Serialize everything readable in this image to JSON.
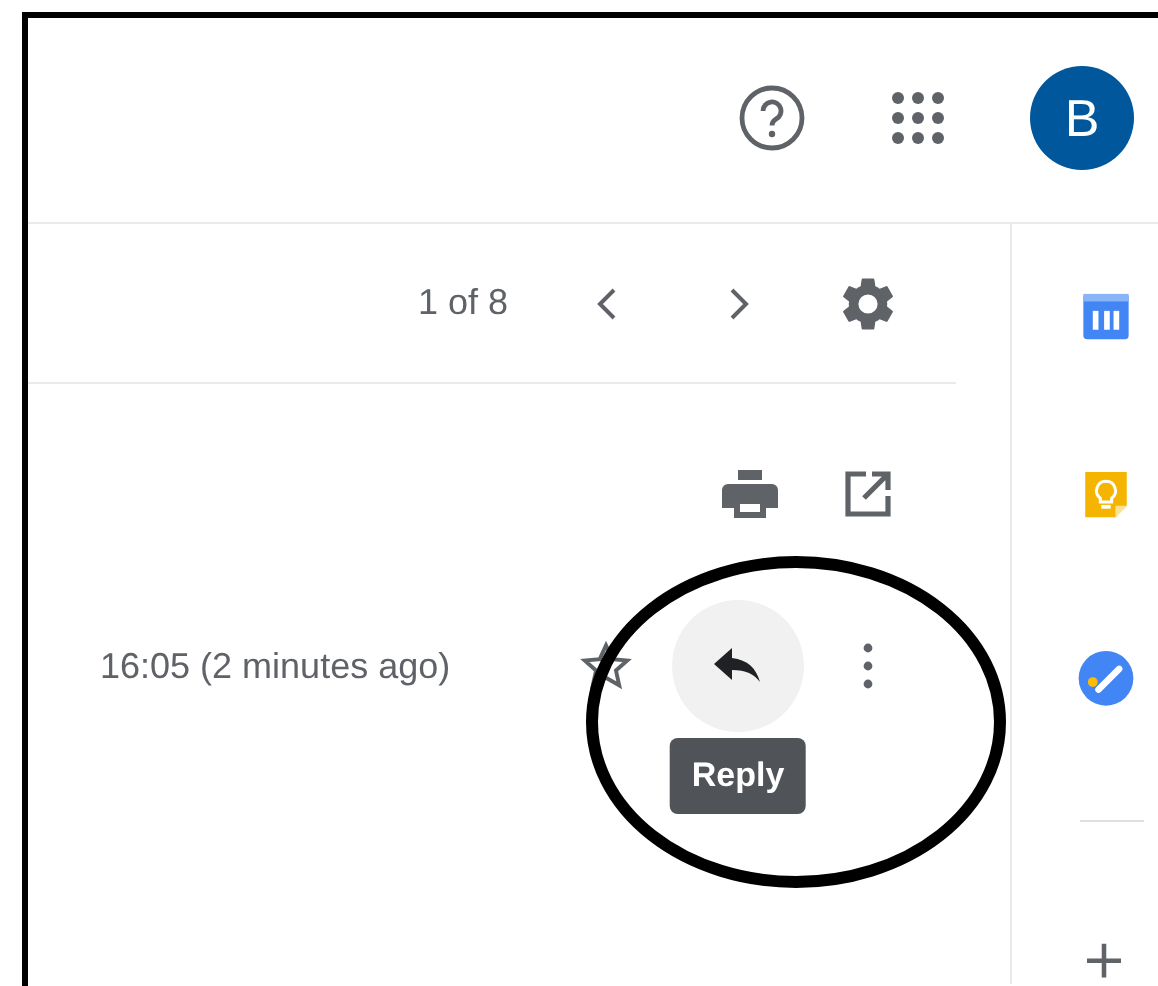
{
  "header": {
    "avatar": {
      "letter": "B"
    }
  },
  "toolbar": {
    "counter": "1 of 8"
  },
  "message": {
    "time": "16:05 (2 minutes ago)",
    "starred": false,
    "tooltip": "Reply"
  }
}
